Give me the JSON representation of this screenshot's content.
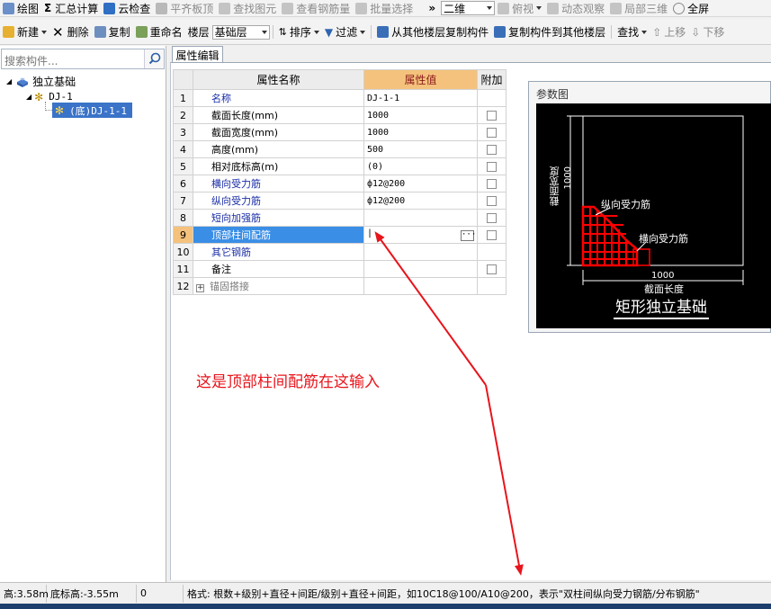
{
  "toolbar1": {
    "items": [
      {
        "label": "绘图",
        "icon": "draw-icon"
      },
      {
        "label": "汇总计算",
        "icon": "sigma-icon"
      },
      {
        "label": "云检查",
        "icon": "cloud-check-icon"
      },
      {
        "label": "平齐板顶",
        "icon": "align-slab-icon"
      },
      {
        "label": "查找图元",
        "icon": "find-element-icon"
      },
      {
        "label": "查看钢筋量",
        "icon": "rebar-qty-icon"
      },
      {
        "label": "批量选择",
        "icon": "batch-select-icon"
      }
    ],
    "view_select": "二维",
    "top_view": "俯视",
    "dynamic_view": "动态观察",
    "local_3d": "局部三维",
    "full_screen": "全屏"
  },
  "toolbar2": {
    "new": "新建",
    "delete": "删除",
    "copy": "复制",
    "rename": "重命名",
    "floor_label": "楼层",
    "floor_value": "基础层",
    "sort": "排序",
    "filter": "过滤",
    "copy_from_floor": "从其他楼层复制构件",
    "copy_to_floor": "复制构件到其他楼层",
    "find": "查找",
    "move_up": "上移",
    "move_down": "下移"
  },
  "left_panel": {
    "search_placeholder": "搜索构件...",
    "tree": {
      "root": "独立基础",
      "child": "DJ-1",
      "leaf": "(底)DJ-1-1"
    }
  },
  "tab": {
    "label": "属性编辑"
  },
  "grid": {
    "headers": {
      "name": "属性名称",
      "value": "属性值",
      "extra": "附加"
    },
    "rows": [
      {
        "no": "1",
        "name": "名称",
        "value": "DJ-1-1",
        "style": "blue",
        "check": false
      },
      {
        "no": "2",
        "name": "截面长度(mm)",
        "value": "1000",
        "style": "black",
        "check": true
      },
      {
        "no": "3",
        "name": "截面宽度(mm)",
        "value": "1000",
        "style": "black",
        "check": true
      },
      {
        "no": "4",
        "name": "高度(mm)",
        "value": "500",
        "style": "black",
        "check": true
      },
      {
        "no": "5",
        "name": "相对底标高(m)",
        "value": "(0)",
        "style": "black",
        "check": true
      },
      {
        "no": "6",
        "name": "横向受力筋",
        "value": "ф12@200",
        "style": "blue",
        "check": true
      },
      {
        "no": "7",
        "name": "纵向受力筋",
        "value": "ф12@200",
        "style": "blue",
        "check": true
      },
      {
        "no": "8",
        "name": "短向加强筋",
        "value": "",
        "style": "blue",
        "check": true
      },
      {
        "no": "9",
        "name": "顶部柱间配筋",
        "value": "|",
        "style": "selected",
        "check": true
      },
      {
        "no": "10",
        "name": "其它钢筋",
        "value": "",
        "style": "blue",
        "check": false
      },
      {
        "no": "11",
        "name": "备注",
        "value": "",
        "style": "black",
        "check": true
      },
      {
        "no": "12",
        "name": "锚固搭接",
        "value": "",
        "style": "grey",
        "check": false
      }
    ]
  },
  "param_diagram": {
    "title": "参数图",
    "width_label": "截面宽度",
    "width_value": "1000",
    "length_label": "截面长度",
    "length_value": "1000",
    "long_rebar": "纵向受力筋",
    "trans_rebar": "横向受力筋",
    "caption": "矩形独立基础"
  },
  "annotation": {
    "text": "这是顶部柱间配筋在这输入",
    "color": "#e8141b"
  },
  "status": {
    "elev1": "高:3.58m",
    "elev2": "底标高:-3.55m",
    "zero": "0",
    "format": "格式: 根数+级别+直径+间距/级别+直径+间距，如10C18@100/A10@200，表示\"双柱间纵向受力钢筋/分布钢筋\""
  },
  "colors": {
    "selection": "#3a8ee6",
    "header_highlight": "#f4c27c",
    "rebar_red": "#ff0000"
  }
}
